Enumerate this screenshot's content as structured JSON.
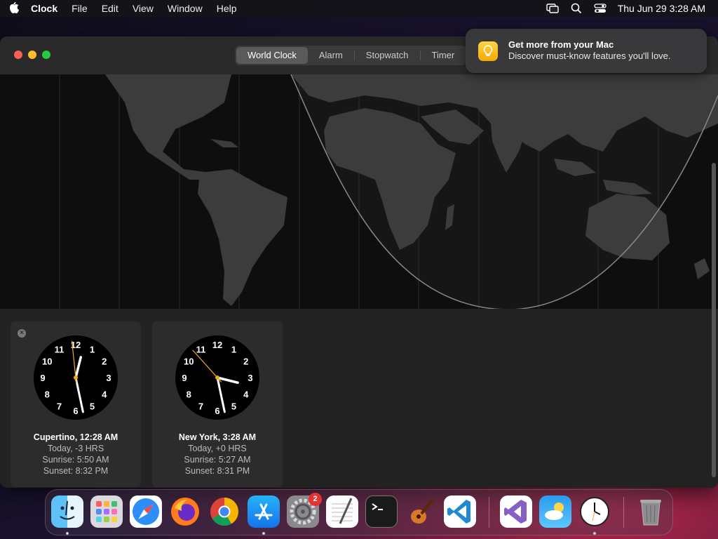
{
  "menubar": {
    "app_name": "Clock",
    "items": [
      "File",
      "Edit",
      "View",
      "Window",
      "Help"
    ],
    "datetime": "Thu Jun 29  3:28 AM"
  },
  "tabs": [
    "World Clock",
    "Alarm",
    "Stopwatch",
    "Timer"
  ],
  "active_tab": "World Clock",
  "notification": {
    "title": "Get more from your Mac",
    "body": "Discover must-know features you'll love."
  },
  "clocks": [
    {
      "city": "Cupertino, 12:28 AM",
      "offset": "Today, -3 HRS",
      "sunrise": "Sunrise: 5:50 AM",
      "sunset": "Sunset: 8:32 PM",
      "hour": 0,
      "minute": 28,
      "second": 59
    },
    {
      "city": "New York, 3:28 AM",
      "offset": "Today, +0 HRS",
      "sunrise": "Sunrise: 5:27 AM",
      "sunset": "Sunset: 8:31 PM",
      "hour": 3,
      "minute": 28,
      "second": 53
    }
  ],
  "clock_numerals": [
    "12",
    "1",
    "2",
    "3",
    "4",
    "5",
    "6",
    "7",
    "8",
    "9",
    "10",
    "11"
  ],
  "dock": {
    "apps": [
      "Finder",
      "Launchpad",
      "Safari",
      "Firefox",
      "Chrome",
      "App Store",
      "System Settings",
      "TextEdit",
      "Terminal",
      "GarageBand",
      "Visual Studio Code",
      "Visual Studio",
      "Weather",
      "Clock",
      "Trash"
    ],
    "settings_badge": "2"
  },
  "colors": {
    "second_hand": "#f5a623",
    "close_red": "#fe5f57",
    "minimize_yellow": "#febc2e",
    "zoom_green": "#28c840",
    "badge_red": "#e8322f"
  }
}
